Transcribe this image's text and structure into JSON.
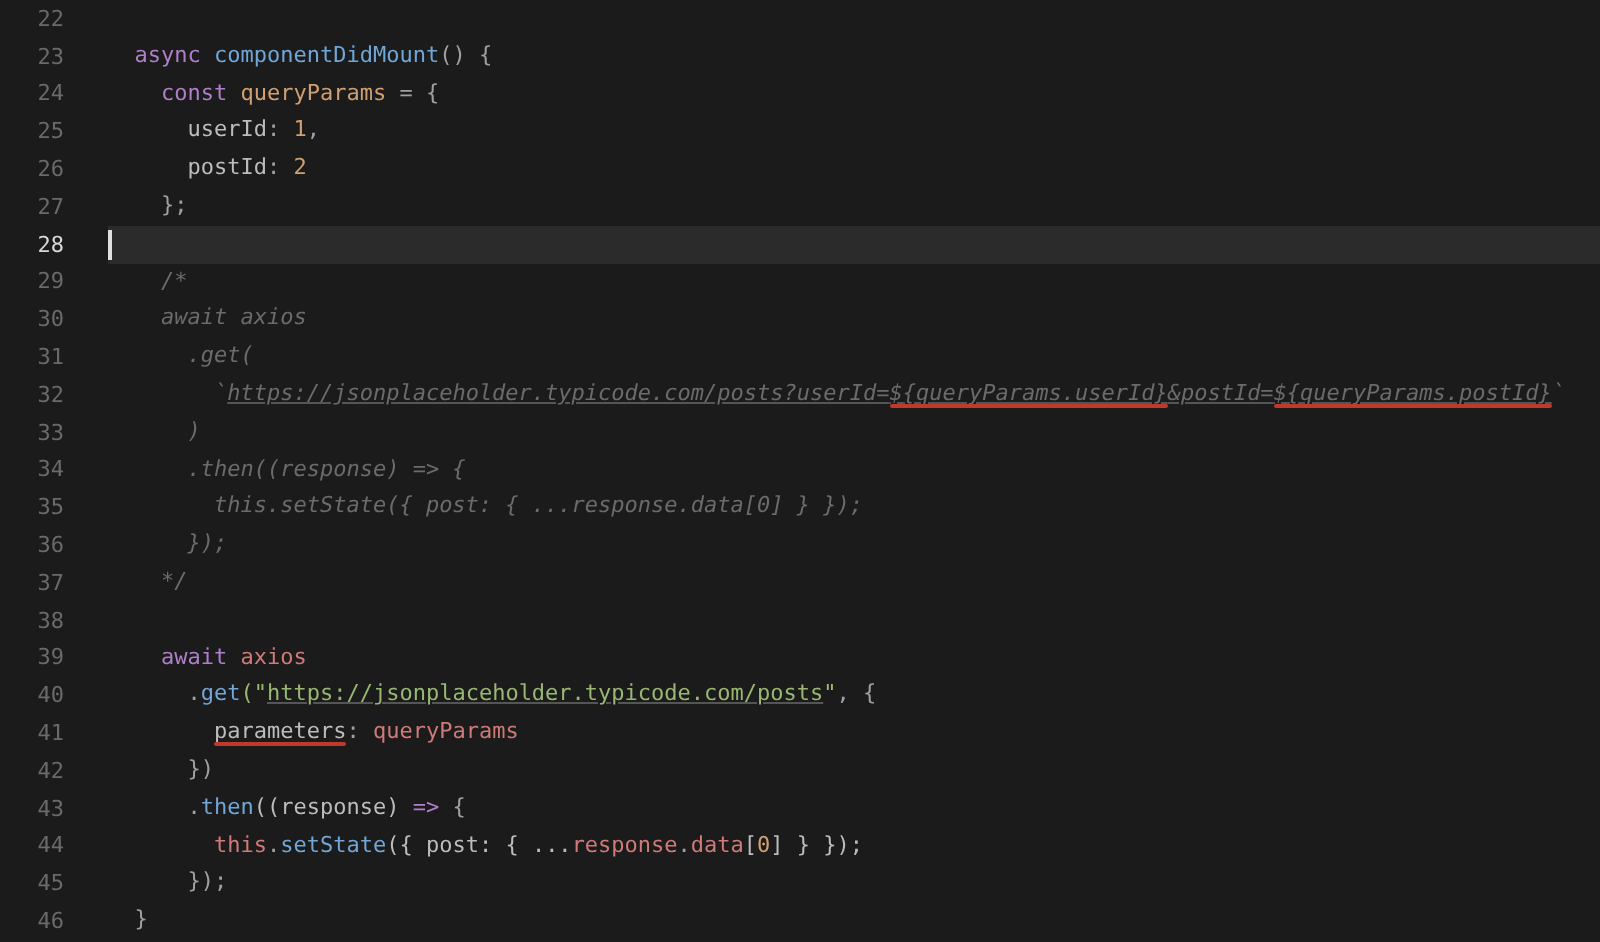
{
  "editor": {
    "lines": [
      {
        "number": "22",
        "current": false
      },
      {
        "number": "23",
        "current": false,
        "tokens": [
          {
            "text": "  async ",
            "kind": "keyword"
          },
          {
            "text": "componentDidMount",
            "kind": "function"
          },
          {
            "text": "() {",
            "kind": "punct"
          }
        ]
      },
      {
        "number": "24",
        "current": false,
        "tokens": [
          {
            "text": "    const ",
            "kind": "keyword"
          },
          {
            "text": "queryParams",
            "kind": "constant"
          },
          {
            "text": " = {",
            "kind": "punct"
          }
        ]
      },
      {
        "number": "25",
        "current": false,
        "tokens": [
          {
            "text": "      userId",
            "kind": "plain"
          },
          {
            "text": ": ",
            "kind": "punct"
          },
          {
            "text": "1",
            "kind": "number"
          },
          {
            "text": ",",
            "kind": "punct"
          }
        ]
      },
      {
        "number": "26",
        "current": false,
        "tokens": [
          {
            "text": "      postId",
            "kind": "plain"
          },
          {
            "text": ": ",
            "kind": "punct"
          },
          {
            "text": "2",
            "kind": "number"
          }
        ]
      },
      {
        "number": "27",
        "current": false,
        "tokens": [
          {
            "text": "    };",
            "kind": "punct"
          }
        ]
      },
      {
        "number": "28",
        "current": true
      },
      {
        "number": "29",
        "current": false,
        "tokens": [
          {
            "text": "    /*",
            "kind": "comment"
          }
        ]
      },
      {
        "number": "30",
        "current": false,
        "tokens": [
          {
            "text": "    await axios",
            "kind": "comment"
          }
        ]
      },
      {
        "number": "31",
        "current": false,
        "tokens": [
          {
            "text": "      .get(",
            "kind": "comment"
          }
        ]
      },
      {
        "number": "32",
        "current": false,
        "tokens": [
          {
            "text": "        `",
            "kind": "comment"
          },
          {
            "text": "https://jsonplaceholder.typicode.com/posts?userId=",
            "kind": "comment-link"
          },
          {
            "text": "${queryParams.userId}",
            "kind": "comment-link",
            "annotated": true
          },
          {
            "text": "&postId=",
            "kind": "comment-link"
          },
          {
            "text": "${queryParams.postId}",
            "kind": "comment-link",
            "annotated": true
          },
          {
            "text": "`",
            "kind": "comment"
          }
        ]
      },
      {
        "number": "33",
        "current": false,
        "tokens": [
          {
            "text": "      )",
            "kind": "comment"
          }
        ]
      },
      {
        "number": "34",
        "current": false,
        "tokens": [
          {
            "text": "      .then((response) => {",
            "kind": "comment"
          }
        ]
      },
      {
        "number": "35",
        "current": false,
        "tokens": [
          {
            "text": "        this.setState({ post: { ...response.data[0] } });",
            "kind": "comment"
          }
        ]
      },
      {
        "number": "36",
        "current": false,
        "tokens": [
          {
            "text": "      });",
            "kind": "comment"
          }
        ]
      },
      {
        "number": "37",
        "current": false,
        "tokens": [
          {
            "text": "    */",
            "kind": "comment"
          }
        ]
      },
      {
        "number": "38",
        "current": false
      },
      {
        "number": "39",
        "current": false,
        "tokens": [
          {
            "text": "    await ",
            "kind": "keyword"
          },
          {
            "text": "axios",
            "kind": "variable"
          }
        ]
      },
      {
        "number": "40",
        "current": false,
        "tokens": [
          {
            "text": "      .",
            "kind": "punct"
          },
          {
            "text": "get",
            "kind": "function"
          },
          {
            "text": "(\"",
            "kind": "string-quote"
          },
          {
            "text": "https://jsonplaceholder.typicode.com/posts",
            "kind": "string-link"
          },
          {
            "text": "\"",
            "kind": "string"
          },
          {
            "text": ", {",
            "kind": "punct"
          }
        ]
      },
      {
        "number": "41",
        "current": false,
        "tokens": [
          {
            "text": "        parameters",
            "kind": "plain",
            "annotated": true
          },
          {
            "text": ": ",
            "kind": "punct"
          },
          {
            "text": "queryParams",
            "kind": "variable"
          }
        ]
      },
      {
        "number": "42",
        "current": false,
        "tokens": [
          {
            "text": "      })",
            "kind": "punct"
          }
        ]
      },
      {
        "number": "43",
        "current": false,
        "tokens": [
          {
            "text": "      .",
            "kind": "punct"
          },
          {
            "text": "then",
            "kind": "function"
          },
          {
            "text": "((response) ",
            "kind": "plain"
          },
          {
            "text": "=>",
            "kind": "keyword"
          },
          {
            "text": " {",
            "kind": "punct"
          }
        ]
      },
      {
        "number": "44",
        "current": false,
        "tokens": [
          {
            "text": "        this",
            "kind": "variable"
          },
          {
            "text": ".",
            "kind": "punct"
          },
          {
            "text": "setState",
            "kind": "function"
          },
          {
            "text": "({ post: { ...",
            "kind": "plain"
          },
          {
            "text": "response",
            "kind": "variable"
          },
          {
            "text": ".",
            "kind": "punct"
          },
          {
            "text": "data",
            "kind": "variable"
          },
          {
            "text": "[",
            "kind": "plain"
          },
          {
            "text": "0",
            "kind": "number"
          },
          {
            "text": "] } });",
            "kind": "plain"
          }
        ]
      },
      {
        "number": "45",
        "current": false,
        "tokens": [
          {
            "text": "      });",
            "kind": "punct"
          }
        ]
      },
      {
        "number": "46",
        "current": false,
        "tokens": [
          {
            "text": "  }",
            "kind": "punct"
          }
        ]
      }
    ]
  }
}
